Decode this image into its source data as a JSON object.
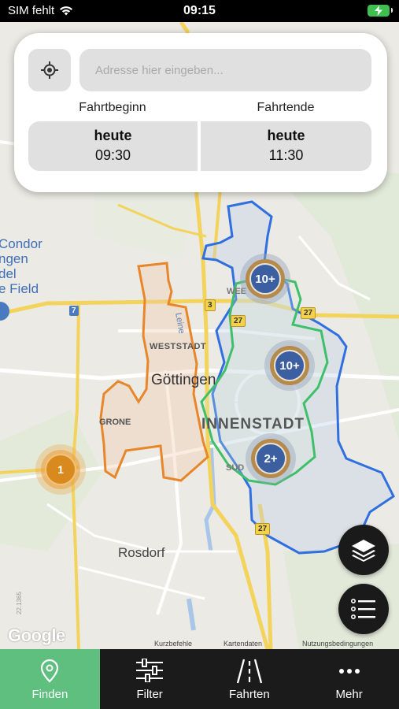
{
  "status_bar": {
    "carrier": "SIM fehlt",
    "time": "09:15"
  },
  "search": {
    "placeholder": "Adresse hier eingeben...",
    "value": ""
  },
  "trip": {
    "start_label": "Fahrtbeginn",
    "start_day": "heute",
    "start_time": "09:30",
    "end_label": "Fahrtende",
    "end_day": "heute",
    "end_time": "11:30"
  },
  "map": {
    "city_label": "Göttingen",
    "district_inner": "INNENSTADT",
    "district_weststadt": "WESTSTADT",
    "district_grone": "GRONE",
    "district_sued": "SÜD",
    "district_weende": "WEE",
    "town_rosdorf": "Rosdorf",
    "river": "Leine",
    "poi_condor": "Condor",
    "poi_condor_line2": "ngen",
    "poi_condor_line3": "del",
    "poi_condor_line4": "e Field",
    "side_text": "22.1365",
    "road_badges": [
      "7",
      "3",
      "27",
      "27",
      "27"
    ],
    "clusters": [
      {
        "label": "10+",
        "color": "blue"
      },
      {
        "label": "10+",
        "color": "blue"
      },
      {
        "label": "2+",
        "color": "blue"
      },
      {
        "label": "1",
        "color": "orange"
      }
    ],
    "attribution": {
      "logo": "Google",
      "shortcuts": "Kurzbefehle",
      "data": "Kartendaten",
      "terms": "Nutzungsbedingungen"
    },
    "zone_colors": {
      "blue_zone": "#2f6fe0",
      "green_zone": "#3fbf6a",
      "orange_zone": "#e8862a"
    }
  },
  "fabs": {
    "layers_icon": "layers-icon",
    "list_icon": "list-icon"
  },
  "nav": {
    "items": [
      {
        "label": "Finden",
        "icon": "location-pin-icon",
        "active": true
      },
      {
        "label": "Filter",
        "icon": "sliders-icon",
        "active": false
      },
      {
        "label": "Fahrten",
        "icon": "road-icon",
        "active": false
      },
      {
        "label": "Mehr",
        "icon": "more-dots-icon",
        "active": false
      }
    ],
    "active_color": "#5fbf7f"
  }
}
